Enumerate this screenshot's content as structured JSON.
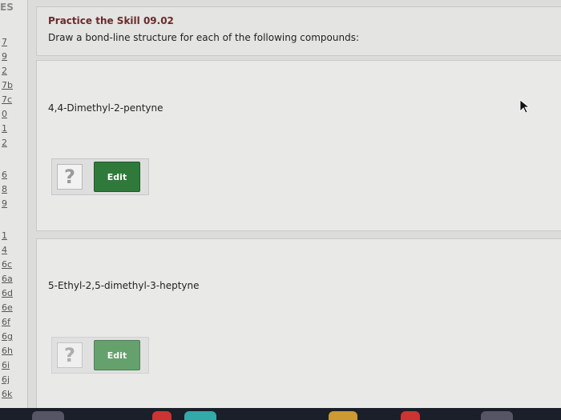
{
  "sidebar": {
    "header": "ES",
    "links": [
      "7",
      "9",
      "2",
      "7b",
      "7c",
      "0",
      "1",
      "2",
      "6",
      "8",
      "9",
      "1",
      "4",
      "6c",
      "6a",
      "6d",
      "6e",
      "6f",
      "6g",
      "6h",
      "6i",
      "6j",
      "6k"
    ]
  },
  "header": {
    "title": "Practice the Skill 09.02",
    "instruction": "Draw a bond-line structure for each of the following compounds:"
  },
  "questions": [
    {
      "name": "4,4-Dimethyl-2-pentyne",
      "placeholder": "?",
      "edit_label": "Edit"
    },
    {
      "name": "5-Ethyl-2,5-dimethyl-3-heptyne",
      "placeholder": "?",
      "edit_label": "Edit"
    }
  ],
  "colors": {
    "edit_button": "#2f7a3b",
    "title": "#6b2a2a"
  }
}
